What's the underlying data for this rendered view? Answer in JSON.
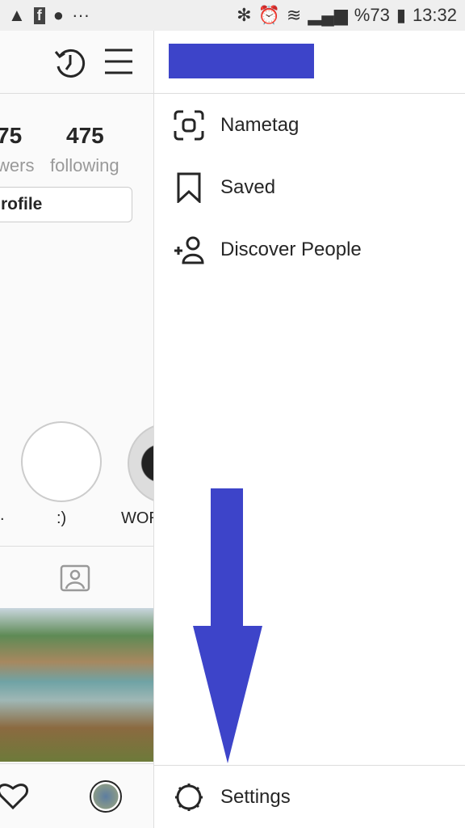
{
  "status_bar": {
    "battery": "%73",
    "time": "13:32"
  },
  "profile": {
    "followers_count": "75",
    "followers_label": "wers",
    "following_count": "475",
    "following_label": "following",
    "edit_profile_label": "rofile",
    "highlights": [
      {
        "label": "."
      },
      {
        "label": ":)"
      },
      {
        "label": "WOR"
      }
    ]
  },
  "drawer": {
    "username_redaction_color": "#3d44c9",
    "items": [
      {
        "label": "Nametag",
        "icon": "nametag-icon"
      },
      {
        "label": "Saved",
        "icon": "bookmark-icon"
      },
      {
        "label": "Discover People",
        "icon": "add-person-icon"
      }
    ],
    "settings_label": "Settings"
  },
  "annotation": {
    "arrow_color": "#3d44c9"
  }
}
